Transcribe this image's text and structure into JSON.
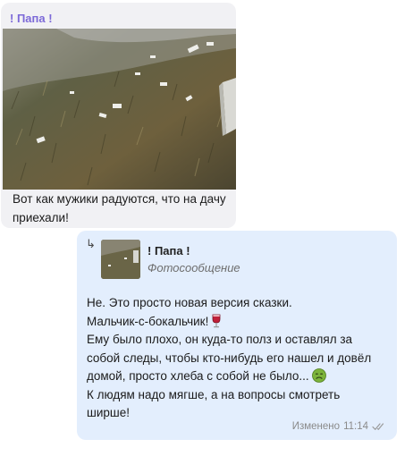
{
  "incoming": {
    "sender": "! Папа !",
    "caption": "Вот как мужики радуются,  что на дачу приехали!"
  },
  "outgoing": {
    "quote": {
      "arrow": "↳",
      "sender": "! Папа !",
      "type": "Фотосообщение"
    },
    "lines": [
      "Не. Это просто новая версия сказки.",
      "Мальчик-с-бокальчик!",
      "Ему было плохо, он куда-то полз и оставлял за",
      "собой следы, чтобы кто-нибудь его нашел и довёл",
      "домой, просто хлеба с собой не было...",
      "К людям надо мягше, а на вопросы смотреть",
      "ширше!"
    ],
    "emoji": {
      "line2": "wine-glass-icon",
      "line5": "nauseated-face-icon"
    },
    "status": {
      "label": "Изменено",
      "time": "11:14",
      "read_state": "double-check-icon"
    }
  },
  "colors": {
    "sender_name": "#7c69d8",
    "incoming_bg": "#f1f1f4",
    "outgoing_bg": "#e3eefd"
  }
}
